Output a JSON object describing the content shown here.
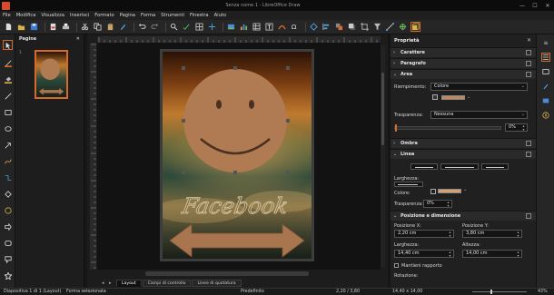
{
  "window": {
    "title": "Senza nome 1 - LibreOffice Draw",
    "buttons": [
      "—",
      "☐",
      "✕"
    ]
  },
  "menu": [
    "File",
    "Modifica",
    "Visualizza",
    "Inserisci",
    "Formato",
    "Pagina",
    "Forma",
    "Strumenti",
    "Finestra",
    "Aiuto"
  ],
  "slide_pane": {
    "title": "Pagine",
    "close": "✕",
    "thumb_number": "1"
  },
  "tabs": {
    "nav": [
      "◂",
      "▸"
    ],
    "items": [
      "Layout",
      "Campi di controllo",
      "Linee di quotatura"
    ]
  },
  "sidebar": {
    "title": "Proprietà",
    "close": "✕",
    "sections": {
      "carattere": "Carattere",
      "paragrafo": "Paragrafo",
      "area": "Area",
      "ombra": "Ombra",
      "linea": "Linea",
      "posizione": "Posizione e dimensione"
    },
    "area": {
      "fill_label": "Riempimento:",
      "fill_value": "Colore",
      "color_hex": "#c1885e",
      "transparency_label": "Trasparenza:",
      "transparency_value": "Nessuna",
      "transparency_percent": "0%"
    },
    "line": {
      "width_label": "Larghezza:",
      "color_label": "Colore:",
      "color_hex": "#d6a070",
      "transparency_label": "Trasparenza:",
      "transparency_value": "0%"
    },
    "position": {
      "posx_label": "Posizione X:",
      "posx_value": "2,20 cm",
      "posy_label": "Posizione Y:",
      "posy_value": "3,80 cm",
      "width_label": "Larghezza:",
      "width_value": "14,40 cm",
      "height_label": "Altezza:",
      "height_value": "14,00 cm",
      "keep_ratio_label": "Mantieni rapporto",
      "rotation_label": "Rotazione:"
    }
  },
  "statusbar": {
    "slide": "Diapositiva 1 di 1 (Layout)",
    "selection": "Forma selezionata",
    "style": "Predefinito",
    "position": "2,20 / 3,80",
    "size": "14,40 x 14,00",
    "zoom": "43%"
  },
  "colors": {
    "accent": "#d46a2c",
    "smiley": "#b07b52",
    "arrow": "#a8754e"
  },
  "canvas": {
    "text_art": "Facebook"
  }
}
